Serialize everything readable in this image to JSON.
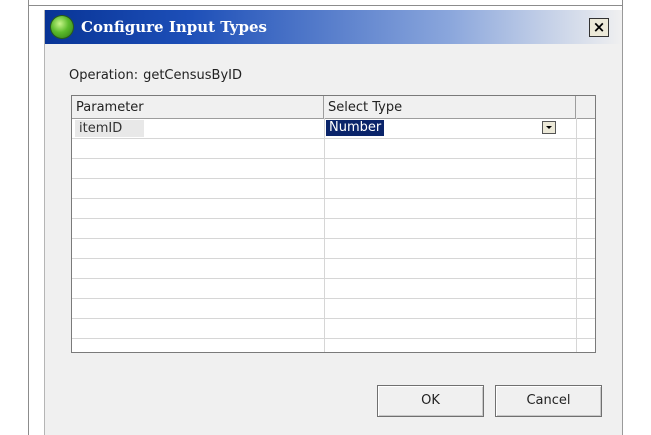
{
  "dialog": {
    "title": "Configure Input Types",
    "close_label": "×"
  },
  "operation": {
    "label": "Operation:",
    "value": "getCensusByID"
  },
  "grid": {
    "headers": [
      "Parameter",
      "Select Type"
    ],
    "rows": [
      {
        "parameter": "itemID",
        "type": "Number"
      }
    ]
  },
  "buttons": {
    "ok": "OK",
    "cancel": "Cancel"
  },
  "icons": {
    "title_icon": "green-globe-icon",
    "dropdown_icon": "chevron-down-icon"
  },
  "colors": {
    "title_gradient_start": "#083496",
    "selection": "#0a246a"
  }
}
